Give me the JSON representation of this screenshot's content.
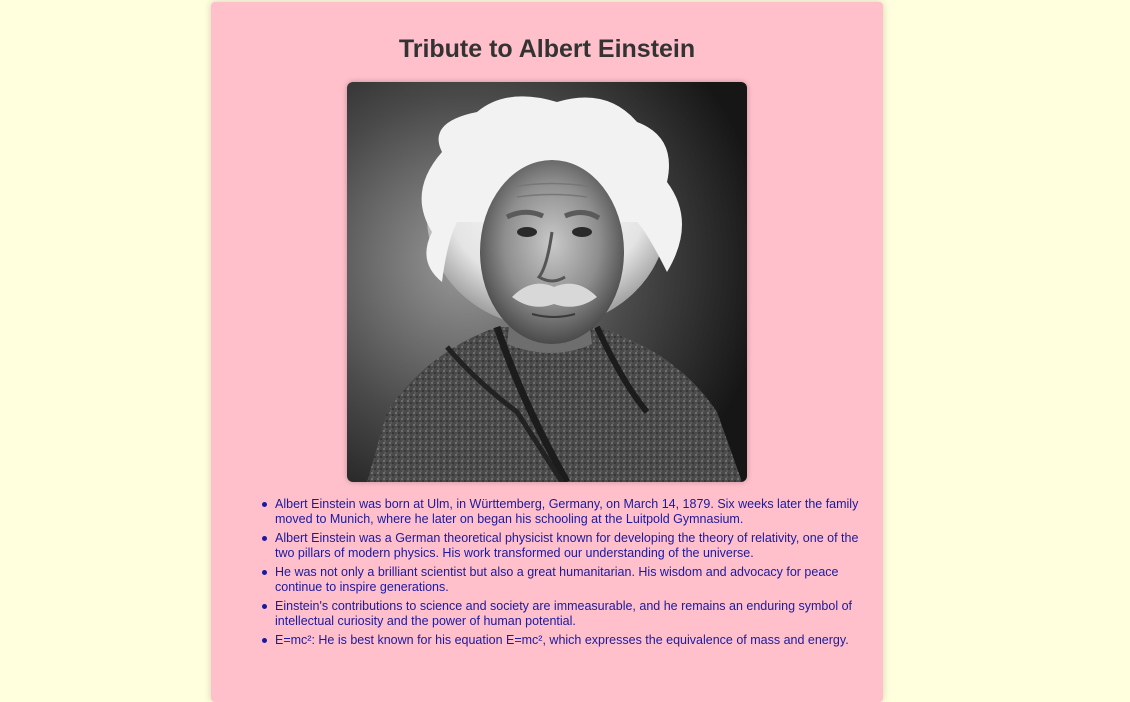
{
  "page": {
    "title": "Tribute to Albert Einstein",
    "image_alt": "Albert Einstein portrait"
  },
  "facts": [
    "Albert Einstein was born at Ulm, in Württemberg, Germany, on March 14, 1879. Six weeks later the family moved to Munich, where he later on began his schooling at the Luitpold Gymnasium.",
    "Albert Einstein was a German theoretical physicist known for developing the theory of relativity, one of the two pillars of modern physics. His work transformed our understanding of the universe.",
    "He was not only a brilliant scientist but also a great humanitarian. His wisdom and advocacy for peace continue to inspire generations.",
    "Einstein's contributions to science and society are immeasurable, and he remains an enduring symbol of intellectual curiosity and the power of human potential.",
    "E=mc²: He is best known for his equation E=mc², which expresses the equivalence of mass and energy."
  ],
  "colors": {
    "background": "#ffffde",
    "card": "#ffc0cb",
    "title": "#333333",
    "text": "#1a1aa0"
  }
}
